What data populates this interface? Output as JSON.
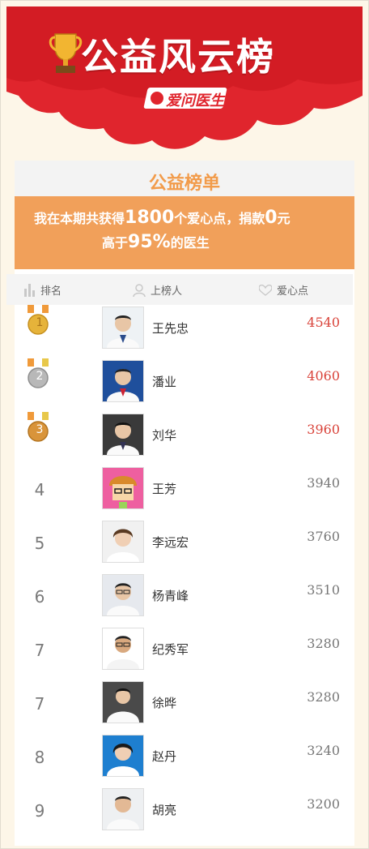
{
  "header": {
    "title": "公益风云榜",
    "logo_text": "爱问医生"
  },
  "panel": {
    "title": "公益榜单"
  },
  "summary": {
    "line1_prefix": "我在本期共获得",
    "points": "1800",
    "line1_mid": "个爱心点，捐款",
    "donation": "0",
    "line1_suffix": "元",
    "line2_prefix": "高于",
    "percent": "95%",
    "line2_suffix": "的医生"
  },
  "columns": {
    "rank": "排名",
    "user": "上榜人",
    "points": "爱心点"
  },
  "rows": [
    {
      "rank": "1",
      "name": "王先忠",
      "score": "4540"
    },
    {
      "rank": "2",
      "name": "潘业",
      "score": "4060"
    },
    {
      "rank": "3",
      "name": "刘华",
      "score": "3960"
    },
    {
      "rank": "4",
      "name": "王芳",
      "score": "3940"
    },
    {
      "rank": "5",
      "name": "李远宏",
      "score": "3760"
    },
    {
      "rank": "6",
      "name": "杨青峰",
      "score": "3510"
    },
    {
      "rank": "7",
      "name": "纪秀军",
      "score": "3280"
    },
    {
      "rank": "7",
      "name": "徐晔",
      "score": "3280"
    },
    {
      "rank": "8",
      "name": "赵丹",
      "score": "3240"
    },
    {
      "rank": "9",
      "name": "胡亮",
      "score": "3200"
    }
  ],
  "colors": {
    "brand_red": "#e0252d",
    "accent_orange": "#f1a05a",
    "gold": "#e6b33a",
    "silver": "#b8b8b8",
    "bronze": "#d9943a"
  },
  "icons": {
    "trophy": "trophy-icon",
    "bar": "bar-chart-icon",
    "person": "person-icon",
    "heart": "heart-icon"
  }
}
